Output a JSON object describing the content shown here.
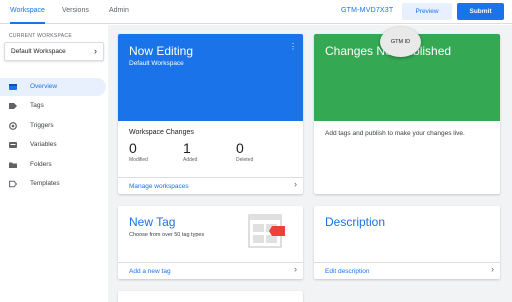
{
  "header": {
    "tabs": [
      {
        "label": "Workspace",
        "active": true
      },
      {
        "label": "Versions",
        "active": false
      },
      {
        "label": "Admin",
        "active": false
      }
    ],
    "container_id": "GTM-MVD7X3T",
    "preview_label": "Preview",
    "submit_label": "Submit",
    "tooltip_label": "GTM ID"
  },
  "sidebar": {
    "workspace_label": "CURRENT WORKSPACE",
    "workspace_name": "Default Workspace",
    "items": [
      {
        "label": "Overview",
        "icon": "overview-icon",
        "active": true
      },
      {
        "label": "Tags",
        "icon": "tag-icon",
        "active": false
      },
      {
        "label": "Triggers",
        "icon": "trigger-icon",
        "active": false
      },
      {
        "label": "Variables",
        "icon": "variables-icon",
        "active": false
      },
      {
        "label": "Folders",
        "icon": "folder-icon",
        "active": false
      },
      {
        "label": "Templates",
        "icon": "template-icon",
        "active": false
      }
    ]
  },
  "now_editing": {
    "title": "Now Editing",
    "workspace": "Default Workspace",
    "changes_title": "Workspace Changes",
    "stats": [
      {
        "value": "0",
        "label": "Modified"
      },
      {
        "value": "1",
        "label": "Added"
      },
      {
        "value": "0",
        "label": "Deleted"
      }
    ],
    "manage_link": "Manage workspaces"
  },
  "changes": {
    "title": "Changes Not Published",
    "body": "Add tags and publish to make your changes live."
  },
  "new_tag": {
    "title": "New Tag",
    "subtitle": "Choose from over 50 tag types",
    "link": "Add a new tag"
  },
  "description": {
    "title": "Description",
    "link": "Edit description"
  },
  "colors": {
    "accent": "#1a73e8",
    "green": "#34a853",
    "tag_red": "#ea4335"
  }
}
